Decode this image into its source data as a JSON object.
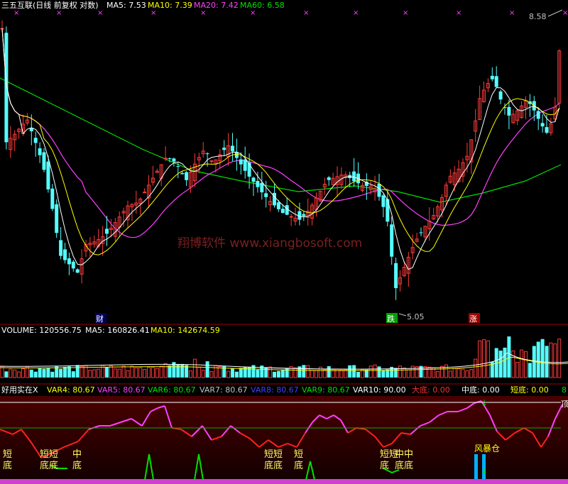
{
  "price_panel": {
    "header": {
      "stock": "三五互联(日线 前复权 对数)",
      "ma5": "MA5: 7.53",
      "ma10": "MA10: 7.39",
      "ma20": "MA20: 7.42",
      "ma60": "MA60: 6.58"
    },
    "high_label": "8.58",
    "low_label": "5.05",
    "badge_cai": "财",
    "badge_die": "跌",
    "badge_zhang": "涨",
    "watermark": "翔博软件 www.xiangbosoft.com",
    "colors": {
      "up": "#ff3a3a",
      "down": "#54ffff",
      "ma5": "#ffffff",
      "ma10": "#ffff00",
      "ma20": "#ff40ff",
      "ma60": "#00e000"
    }
  },
  "volume_panel": {
    "volume": "VOLUME: 120556.75",
    "ma5": "MA5: 160826.41",
    "ma10": "MA10: 142674.59"
  },
  "indicator_panel": {
    "name": "好用实在X",
    "var4": "VAR4: 80.67",
    "var5": "VAR5: 80.67",
    "var6": "VAR6: 80.67",
    "var7": "VAR7: 80.67",
    "var8": "VAR8: 80.67",
    "var9": "VAR9: 80.67",
    "var10": "VAR10: 90.00",
    "dadi": "大底: 0.00",
    "zhongdi": "中底: 0.00",
    "duandi": "短底: 0.00",
    "edge_left": "8",
    "edge_right": "顶",
    "fengbao": "风暴仓",
    "labels": [
      "短底",
      "短底",
      "短底",
      "中底",
      "短底",
      "短底",
      "短底",
      "短底",
      "中底"
    ],
    "label_groups": [
      {
        "top": "短",
        "bottom": "底"
      },
      {
        "top": "短短",
        "bottom": "底底"
      },
      {
        "top": "中",
        "bottom": "底"
      },
      {
        "top": "短短",
        "bottom": "底底"
      },
      {
        "top": "短",
        "bottom": "底"
      },
      {
        "top": "短短",
        "bottom": "底"
      },
      {
        "top": "中中",
        "bottom": "底底"
      }
    ]
  },
  "chart_data": {
    "type": "candlestick",
    "title": "三五互联(日线 前复权 对数)",
    "price_high": 8.58,
    "price_low": 5.05,
    "series": [
      {
        "name": "MA5",
        "value": 7.53
      },
      {
        "name": "MA10",
        "value": 7.39
      },
      {
        "name": "MA20",
        "value": 7.42
      },
      {
        "name": "MA60",
        "value": 6.58
      }
    ],
    "volume": 120556.75,
    "volume_ma5": 160826.41,
    "volume_ma10": 142674.59,
    "indicator_values": {
      "VAR4": 80.67,
      "VAR5": 80.67,
      "VAR6": 80.67,
      "VAR7": 80.67,
      "VAR8": 80.67,
      "VAR9": 80.67,
      "VAR10": 90.0,
      "大底": 0.0,
      "中底": 0.0,
      "短底": 0.0
    }
  }
}
